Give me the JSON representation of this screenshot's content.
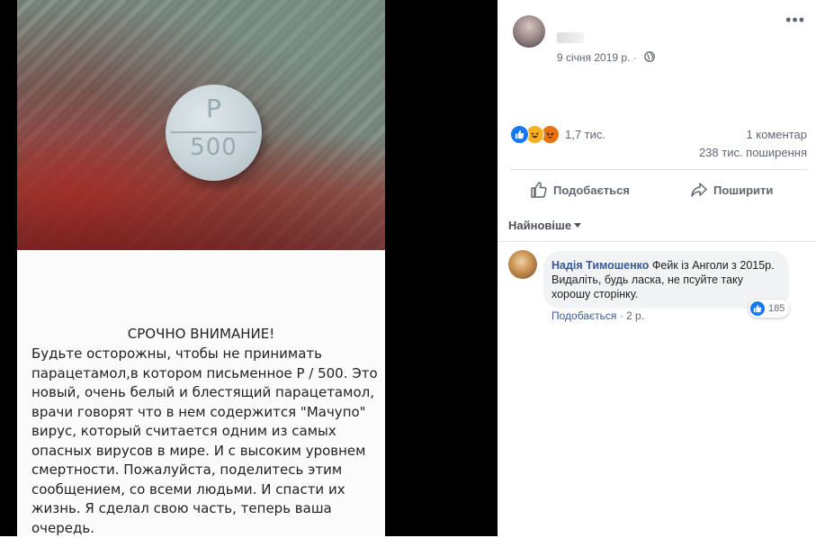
{
  "photo": {
    "pill_top": "P",
    "pill_bottom": "500"
  },
  "notice": {
    "title": "СРОЧНО ВНИМАНИЕ!",
    "body": "Будьте осторожны, чтобы не принимать\nпарацетамол,в  котором  письменное Р / 500. Это\nновый, очень белый и блестящий парацетамол,\nврачи говорят что в нем  содержится \"Мачупо\"\nвирус, который считается одним из самых\nопасных вирусов в мире. И с высоким уровнем\nсмертности. Пожалуйста, поделитесь этим\nсообщением, со всеми людьми.  И спасти их\nжизнь. Я сделал свою часть, теперь ваша\nочередь."
  },
  "post": {
    "date": "9 січня 2019 р. ·",
    "more_icon": "more-options-icon",
    "globe_icon": "globe-icon"
  },
  "stats": {
    "reactions_count": "1,7 тис.",
    "reaction_icons": [
      "like-icon",
      "haha-icon",
      "angry-icon"
    ],
    "comments": "1 коментар",
    "shares": "238 тис. поширення"
  },
  "actions": {
    "like": "Подобається",
    "share": "Поширити"
  },
  "comments_sort": "Найновіше",
  "comment": {
    "author": "Надія Тимошенко",
    "text": "Фейк із Анголи з 2015р. Видаліть, будь ласка, не псуйте таку хорошу сторінку.",
    "reaction_count": "185",
    "like_label": "Подобається",
    "separator": " · ",
    "time": "2 р."
  },
  "colors": {
    "like_blue": "#1877f2",
    "link_blue": "#385898",
    "muted_text": "#606770"
  }
}
